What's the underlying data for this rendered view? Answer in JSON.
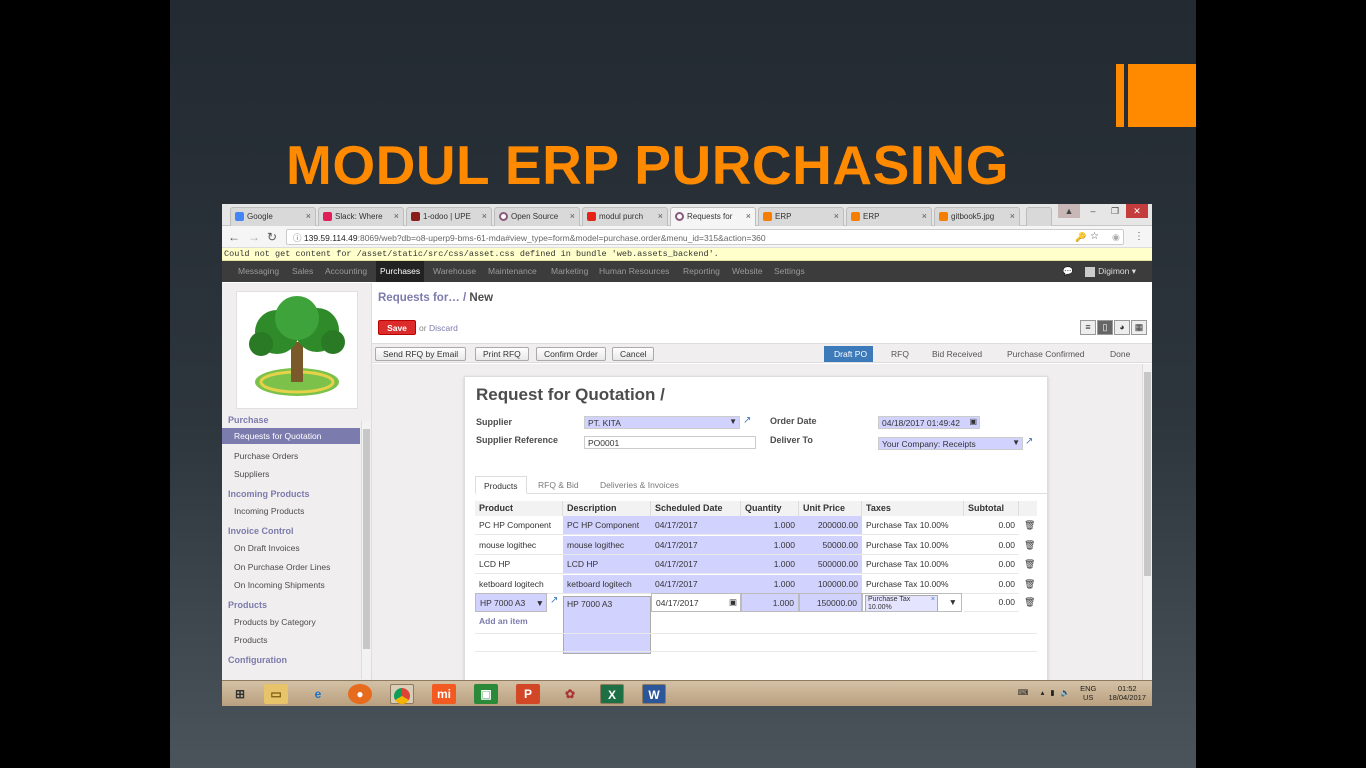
{
  "slide": {
    "title": "MODUL ERP PURCHASING"
  },
  "browser": {
    "tabs": [
      {
        "label": "Google",
        "color": "#4285f4"
      },
      {
        "label": "Slack: Where",
        "color": "#e01e5a"
      },
      {
        "label": "1-odoo | UPE",
        "color": "#8b1c1c"
      },
      {
        "label": "Open Source",
        "color": "#875a7b"
      },
      {
        "label": "modul purch",
        "color": "#e62117"
      },
      {
        "label": "Requests for",
        "color": "#875a7b"
      },
      {
        "label": "ERP",
        "color": "#f57d00"
      },
      {
        "label": "ERP",
        "color": "#f57d00"
      },
      {
        "label": "gitbook5.jpg",
        "color": "#f57d00"
      }
    ],
    "url_host": "139.59.114.49",
    "url_rest": ":8069/web?db=o8-uperp9-bms-61-mda#view_type=form&model=purchase.order&menu_id=315&action=360",
    "error": "Could not get content for /asset/static/src/css/asset.css defined in bundle 'web.assets_backend'."
  },
  "topnav": {
    "items": [
      "Messaging",
      "Sales",
      "Accounting",
      "Purchases",
      "Warehouse",
      "Maintenance",
      "Marketing",
      "Human Resources",
      "Reporting",
      "Website",
      "Settings"
    ],
    "active": "Purchases",
    "user": "Digimon"
  },
  "sidebar": {
    "sections": [
      {
        "title": "Purchase",
        "items": [
          "Requests for Quotation",
          "Purchase Orders",
          "Suppliers"
        ]
      },
      {
        "title": "Incoming Products",
        "items": [
          "Incoming Products"
        ]
      },
      {
        "title": "Invoice Control",
        "items": [
          "On Draft Invoices",
          "On Purchase Order Lines",
          "On Incoming Shipments"
        ]
      },
      {
        "title": "Products",
        "items": [
          "Products by Category",
          "Products"
        ]
      },
      {
        "title": "Configuration",
        "items": []
      }
    ]
  },
  "header": {
    "breadcrumb_parent": "Requests for…",
    "breadcrumb_sep": " / ",
    "breadcrumb_current": "New",
    "save_label": "Save",
    "or_label": "or",
    "discard_label": "Discard"
  },
  "toolbar": {
    "buttons": [
      "Send RFQ by Email",
      "Print RFQ",
      "Confirm Order",
      "Cancel"
    ],
    "stages": [
      "Draft PO",
      "RFQ",
      "Bid Received",
      "Purchase Confirmed",
      "Done"
    ],
    "active_stage": "Draft PO"
  },
  "form": {
    "title": "Request for Quotation /",
    "supplier_label": "Supplier",
    "supplier_value": "PT. KITA",
    "supplier_ref_label": "Supplier Reference",
    "supplier_ref_value": "PO0001",
    "order_date_label": "Order Date",
    "order_date_value": "04/18/2017 01:49:42",
    "deliver_to_label": "Deliver To",
    "deliver_to_value": "Your Company: Receipts",
    "tabs": [
      "Products",
      "RFQ & Bid",
      "Deliveries & Invoices"
    ],
    "columns": [
      "Product",
      "Description",
      "Scheduled Date",
      "Quantity",
      "Unit Price",
      "Taxes",
      "Subtotal"
    ],
    "rows": [
      {
        "product": "PC HP Component",
        "description": "PC HP Component",
        "date": "04/17/2017",
        "qty": "1.000",
        "price": "200000.00",
        "tax": "Purchase Tax 10.00%",
        "subtotal": "0.00"
      },
      {
        "product": "mouse logithec",
        "description": "mouse logithec",
        "date": "04/17/2017",
        "qty": "1.000",
        "price": "50000.00",
        "tax": "Purchase Tax 10.00%",
        "subtotal": "0.00"
      },
      {
        "product": "LCD HP",
        "description": "LCD HP",
        "date": "04/17/2017",
        "qty": "1.000",
        "price": "500000.00",
        "tax": "Purchase Tax 10.00%",
        "subtotal": "0.00"
      },
      {
        "product": "ketboard logitech",
        "description": "ketboard logitech",
        "date": "04/17/2017",
        "qty": "1.000",
        "price": "100000.00",
        "tax": "Purchase Tax 10.00%",
        "subtotal": "0.00"
      }
    ],
    "edit_row": {
      "product": "HP 7000 A3",
      "description": "HP 7000 A3",
      "date": "04/17/2017",
      "qty": "1.000",
      "price": "150000.00",
      "tax_tag_1": "Purchase Tax",
      "tax_tag_2": "10.00%",
      "subtotal": "0.00"
    },
    "add_item": "Add an item"
  },
  "taskbar": {
    "lang": "ENG",
    "region": "US",
    "time": "01:52",
    "date": "18/04/2017"
  }
}
